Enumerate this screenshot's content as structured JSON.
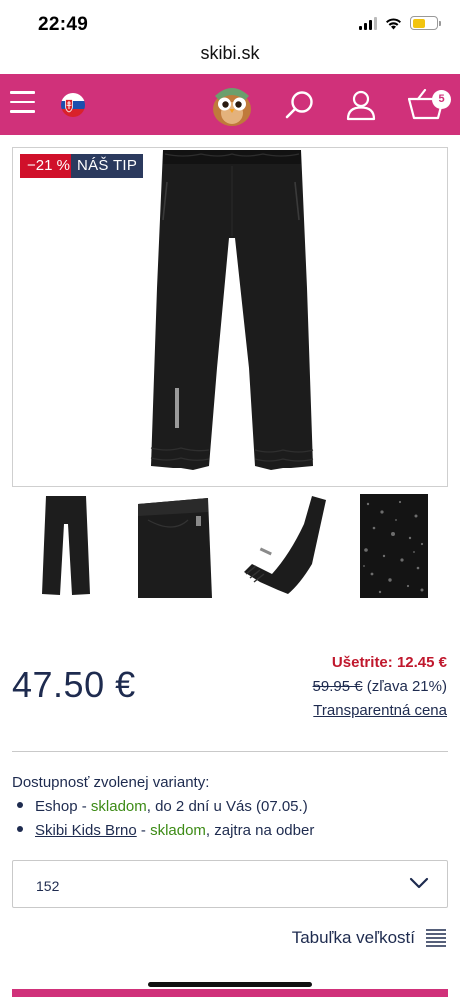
{
  "status_bar": {
    "time": "22:49"
  },
  "browser": {
    "url": "skibi.sk"
  },
  "header": {
    "cart_count": "5"
  },
  "product": {
    "badges": {
      "discount": "−21 %",
      "tip": "NÁŠ TIP"
    },
    "price": "47.50 €",
    "savings": "Ušetrite: 12.45 €",
    "old_price": "59.95 €",
    "discount_note": "(zľava 21%)",
    "transparent_price": "Transparentná cena"
  },
  "availability": {
    "title": "Dostupnosť zvolenej varianty:",
    "items": [
      {
        "location": "Eshop",
        "sep": " - ",
        "status": "skladom",
        "detail": ", do 2 dní u Vás (07.05.)"
      },
      {
        "location": "Skibi Kids Brno",
        "sep": " - ",
        "status": "skladom",
        "detail": ", zajtra na odber"
      }
    ]
  },
  "size_select": {
    "value": "152"
  },
  "size_table_label": "Tabuľka veľkostí",
  "colors": {
    "brand": "#d0317a",
    "navy": "#1e2b4f",
    "red": "#c0182d",
    "green": "#3d8b16"
  },
  "icons": [
    "hamburger-icon",
    "slovak-flag-icon",
    "owl-logo",
    "search-icon",
    "user-icon",
    "cart-icon",
    "chevron-down-icon",
    "table-lines-icon"
  ]
}
